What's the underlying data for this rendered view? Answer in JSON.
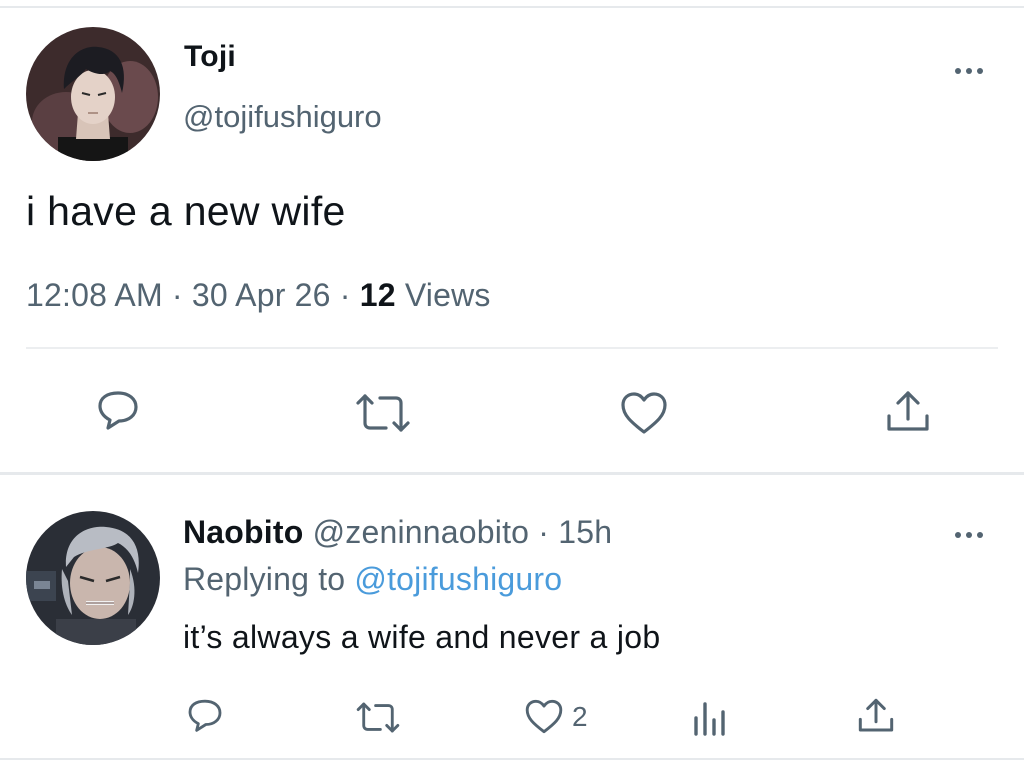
{
  "tweet": {
    "author_name": "Toji",
    "author_handle": "@tojifushiguro",
    "text": "i have a new wife",
    "time": "12:08 AM",
    "separator": "·",
    "date": "30 Apr 26",
    "views_count": "12",
    "views_label": "Views"
  },
  "reply": {
    "author_name": "Naobito",
    "author_handle": "@zeninnaobito",
    "separator": "·",
    "time_ago": "15h",
    "replying_prefix": "Replying to",
    "replying_handle": "@tojifushiguro",
    "text": "it’s always a wife and never a job",
    "like_count": "2"
  },
  "icons": {
    "actions": [
      "reply-icon",
      "retweet-icon",
      "like-icon",
      "share-icon"
    ],
    "reply_actions": [
      "reply-icon",
      "retweet-icon",
      "like-icon",
      "views-icon",
      "share-icon"
    ],
    "more": "more-icon"
  },
  "colors": {
    "text": "#0f1419",
    "secondary": "#536471",
    "link": "#4a9bdb",
    "divider": "#e6e9ec"
  }
}
